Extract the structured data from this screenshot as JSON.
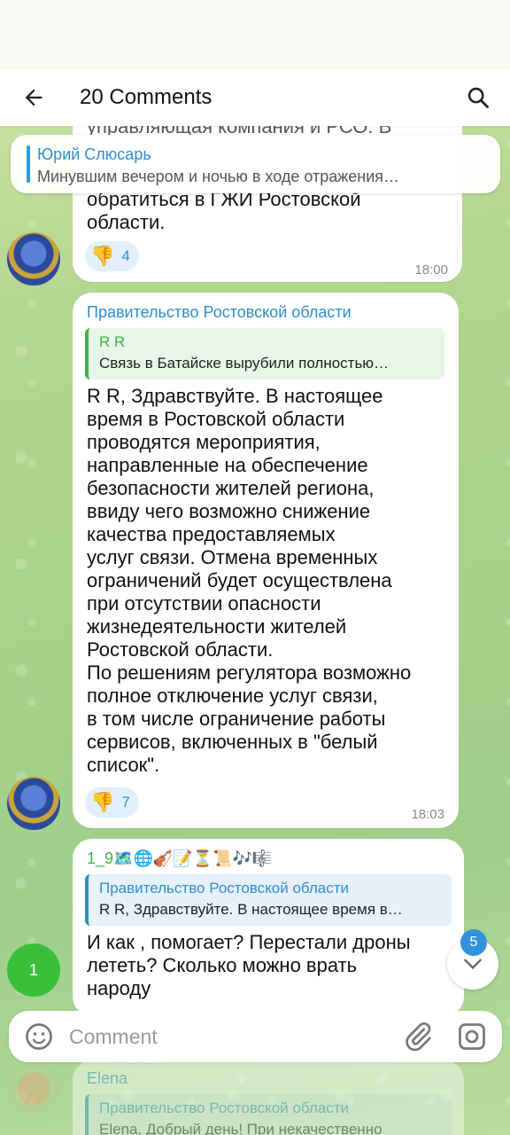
{
  "header": {
    "title": "20 Comments",
    "back_icon": "arrow-left-icon",
    "search_icon": "search-icon"
  },
  "pinned_reply": {
    "name": "Юрий Слюсарь",
    "text": "Минувшим вечером и ночью в ходе отражения…"
  },
  "messages": [
    {
      "partial_top_line": "управляющая компания и РСО. В",
      "text_lines": [
        "обратиться в ГЖИ Ростовской",
        "области."
      ],
      "reaction": {
        "emoji": "👎",
        "count": "4"
      },
      "time": "18:00"
    },
    {
      "sender": "Правительство Ростовской области",
      "reply": {
        "name": "R R",
        "text": "Связь в Батайске вырубили полностью…"
      },
      "text_lines": [
        "R R, Здравствуйте. В настоящее",
        "время в Ростовской области",
        "проводятся мероприятия,",
        "направленные на обеспечение",
        "безопасности жителей региона,",
        "ввиду чего возможно снижение",
        "качества предоставляемых",
        "услуг связи. Отмена временных",
        "ограничений будет осуществлена",
        "при отсутствии опасности",
        "жизнедеятельности жителей",
        "Ростовской области.",
        "По решениям регулятора возможно",
        "полное отключение услуг связи,",
        "в том числе ограничение работы",
        "сервисов, включенных в \"белый",
        "список\"."
      ],
      "reaction": {
        "emoji": "👎",
        "count": "7"
      },
      "time": "18:03"
    },
    {
      "sender": "1_9🗺️🌐🎻📝⏳📜🎶🎼",
      "avatar_label": "1",
      "reply": {
        "name": "Правительство Ростовской области",
        "text": "R R, Здравствуйте. В настоящее время в…"
      },
      "text_lines": [
        "И как , помогает? Перестали дроны",
        "лететь? Сколько можно врать",
        "народу"
      ]
    },
    {
      "sender": "Elena",
      "reply": {
        "name": "Правительство Ростовской области",
        "text": "Elena, Добрый день! При некачественно"
      }
    }
  ],
  "scroll": {
    "unread_count": "5"
  },
  "composer": {
    "placeholder": "Comment"
  }
}
